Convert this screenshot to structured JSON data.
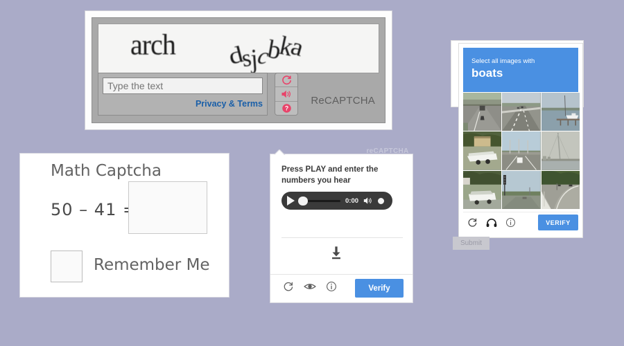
{
  "page": {
    "background_color": "#aaabc8",
    "title": "Captcha types collage"
  },
  "recaptcha_text": {
    "brand_label": "ReCAPTCHA",
    "challenge_word_1": "arch",
    "challenge_word_2": "dsjcbka",
    "input_placeholder": "Type the text",
    "input_value": "",
    "privacy_link": "Privacy & Terms",
    "icons": [
      "refresh-icon",
      "audio-icon",
      "help-icon"
    ],
    "icon_color": "#e8446a"
  },
  "math_captcha": {
    "title": "Math Captcha",
    "equation": "50 – 41 =",
    "answer_value": "",
    "remember_label": "Remember Me",
    "remember_checked": false
  },
  "audio_captcha": {
    "ghost_label": "reCAPTCHA",
    "instruction": "Press PLAY and enter the numbers you hear",
    "player": {
      "play_label": "play-button",
      "time": "0:00",
      "progress_percent": 0,
      "volume_percent": 100
    },
    "download_label": "download-icon",
    "footer_icons": [
      "refresh-icon",
      "eye-icon",
      "info-icon"
    ],
    "verify_label": "Verify",
    "accent_color": "#4a90e2"
  },
  "image_captcha": {
    "prompt": "Select all images with",
    "target": "boats",
    "header_color": "#4a90e2",
    "tiles": [
      {
        "id": "tile-1",
        "scene": "highway-overpass-with-car",
        "selected": false
      },
      {
        "id": "tile-2",
        "scene": "multilane-highway",
        "selected": false
      },
      {
        "id": "tile-3",
        "scene": "sailboat-at-dock",
        "selected": false
      },
      {
        "id": "tile-4",
        "scene": "boat-on-trailer-by-building",
        "selected": false
      },
      {
        "id": "tile-5",
        "scene": "highway-overpass-with-van",
        "selected": false
      },
      {
        "id": "tile-6",
        "scene": "hazy-waterfront-bridge",
        "selected": false
      },
      {
        "id": "tile-7",
        "scene": "boat-on-trailer-in-yard",
        "selected": false
      },
      {
        "id": "tile-8",
        "scene": "road-with-traffic-light",
        "selected": false
      },
      {
        "id": "tile-9",
        "scene": "curved-road-with-guardrail",
        "selected": false
      }
    ],
    "footer_icons": [
      "refresh-icon",
      "headphones-icon",
      "info-icon"
    ],
    "verify_label": "VERIFY"
  },
  "submit_button": {
    "label": "Submit"
  }
}
